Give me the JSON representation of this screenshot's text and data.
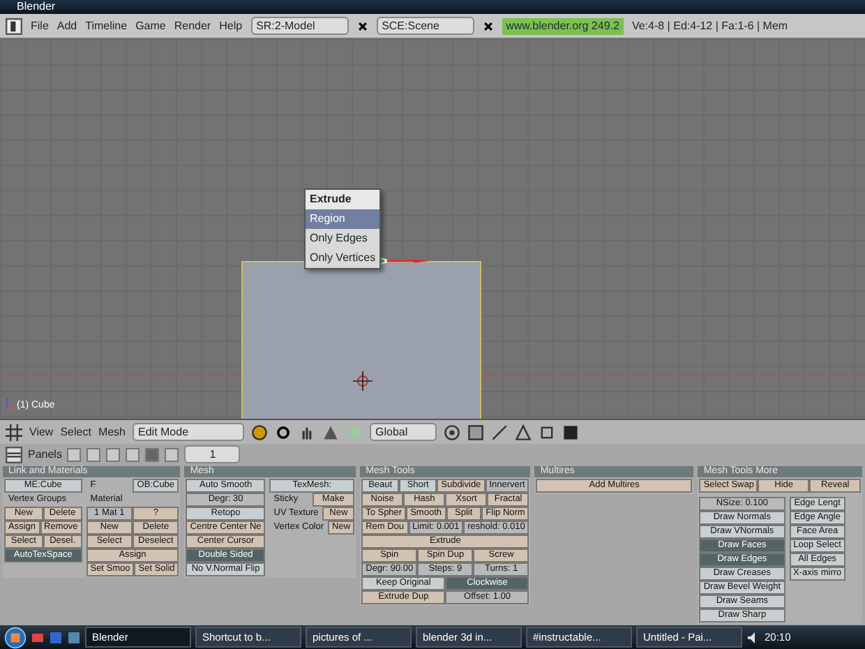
{
  "title_bar": {
    "title": "Blender"
  },
  "menu_bar": {
    "menus": [
      "File",
      "Add",
      "Timeline",
      "Game",
      "Render",
      "Help"
    ],
    "screen": "SR:2-Model",
    "scene": "SCE:Scene",
    "url": "www.blender.org 249.2",
    "stats": "Ve:4-8 | Ed:4-12 | Fa:1-6 | Mem"
  },
  "viewport": {
    "object_label": "(1) Cube",
    "popup": {
      "title": "Extrude",
      "items": [
        {
          "label": "Region",
          "selected": true
        },
        {
          "label": "Only Edges",
          "selected": false
        },
        {
          "label": "Only Vertices",
          "selected": false
        }
      ]
    }
  },
  "view_header": {
    "menus": [
      "View",
      "Select",
      "Mesh"
    ],
    "mode": "Edit Mode",
    "orientation": "Global"
  },
  "buttons_header": {
    "label": "Panels",
    "context_tabs": [
      {
        "selected": false
      },
      {
        "selected": false
      },
      {
        "selected": false
      },
      {
        "selected": false
      },
      {
        "selected": true
      },
      {
        "selected": false
      }
    ],
    "frame": "1"
  },
  "panels": [
    {
      "title": "Link and Materials",
      "columns": [
        [
          [
            {
              "label": "ME:Cube",
              "kind": "field"
            }
          ],
          [
            {
              "label": "Vertex Groups",
              "kind": "text"
            }
          ],
          [
            {
              "label": "New",
              "kind": "button"
            },
            {
              "label": "Delete",
              "kind": "button"
            }
          ],
          [
            {
              "label": "Assign",
              "kind": "button"
            },
            {
              "label": "Remove",
              "kind": "button"
            }
          ],
          [
            {
              "label": "Select",
              "kind": "button"
            },
            {
              "label": "Desel.",
              "kind": "button"
            }
          ],
          [
            {
              "label": "AutoTexSpace",
              "kind": "active"
            }
          ]
        ],
        [
          [
            {
              "label": "F",
              "kind": "text"
            },
            {
              "label": "OB:Cube",
              "kind": "field"
            }
          ],
          [
            {
              "label": "Material",
              "kind": "text"
            }
          ],
          [
            {
              "label": "1 Mat 1",
              "kind": "number"
            },
            {
              "label": "?",
              "kind": "button"
            }
          ],
          [
            {
              "label": "New",
              "kind": "button"
            },
            {
              "label": "Delete",
              "kind": "button"
            }
          ],
          [
            {
              "label": "Select",
              "kind": "button"
            },
            {
              "label": "Deselect",
              "kind": "button"
            }
          ],
          [
            {
              "label": "Assign",
              "kind": "button"
            }
          ],
          [
            {
              "label": "Set Smoo",
              "kind": "button"
            },
            {
              "label": "Set Solid",
              "kind": "button"
            }
          ]
        ]
      ]
    },
    {
      "title": "Mesh",
      "columns": [
        [
          [
            {
              "label": "Auto Smooth",
              "kind": "field"
            }
          ],
          [
            {
              "label": "Degr: 30",
              "kind": "number"
            }
          ],
          [
            {
              "label": "Retopo",
              "kind": "field"
            }
          ],
          [
            {
              "label": "Centre Center Ne",
              "kind": "button"
            }
          ],
          [
            {
              "label": "Center Cursor",
              "kind": "button"
            }
          ],
          [
            {
              "label": "Double Sided",
              "kind": "active"
            }
          ],
          [
            {
              "label": "No V.Normal Flip",
              "kind": "field"
            }
          ]
        ],
        [
          [
            {
              "label": "TexMesh:",
              "kind": "field"
            }
          ],
          [
            {
              "label": "Sticky",
              "kind": "text"
            },
            {
              "label": "Make",
              "kind": "button"
            }
          ],
          [
            {
              "label": "UV Texture",
              "kind": "text"
            },
            {
              "label": "New",
              "kind": "button"
            }
          ],
          [
            {
              "label": "Vertex Color",
              "kind": "text"
            },
            {
              "label": "New",
              "kind": "button"
            }
          ]
        ]
      ]
    },
    {
      "title": "Mesh Tools",
      "columns": [
        [
          [
            {
              "label": "Beaut",
              "kind": "field"
            },
            {
              "label": "Short",
              "kind": "field"
            },
            {
              "label": "Subdivide",
              "kind": "button"
            },
            {
              "label": "Innervert",
              "kind": "number"
            }
          ],
          [
            {
              "label": "Noise",
              "kind": "button"
            },
            {
              "label": "Hash",
              "kind": "button"
            },
            {
              "label": "Xsort",
              "kind": "button"
            },
            {
              "label": "Fractal",
              "kind": "button"
            }
          ],
          [
            {
              "label": "To Spher",
              "kind": "button"
            },
            {
              "label": "Smooth",
              "kind": "button"
            },
            {
              "label": "Split",
              "kind": "button"
            },
            {
              "label": "Flip Norm",
              "kind": "button"
            }
          ],
          [
            {
              "label": "Rem Dou",
              "kind": "button"
            },
            {
              "label": "Limit: 0.001",
              "kind": "number"
            },
            {
              "label": "reshold: 0.010",
              "kind": "number"
            }
          ],
          [
            {
              "label": "Extrude",
              "kind": "button"
            }
          ],
          [
            {
              "label": "Spin",
              "kind": "button"
            },
            {
              "label": "Spin Dup",
              "kind": "button"
            },
            {
              "label": "Screw",
              "kind": "button"
            }
          ],
          [
            {
              "label": "Degr: 90.00",
              "kind": "number"
            },
            {
              "label": "Steps: 9",
              "kind": "number"
            },
            {
              "label": "Turns: 1",
              "kind": "number"
            }
          ],
          [
            {
              "label": "Keep Original",
              "kind": "field"
            },
            {
              "label": "Clockwise",
              "kind": "active"
            }
          ],
          [
            {
              "label": "Extrude Dup",
              "kind": "button"
            },
            {
              "label": "Offset: 1.00",
              "kind": "number"
            }
          ]
        ]
      ]
    },
    {
      "title": "Multires",
      "columns": [
        [
          [
            {
              "label": "Add Multires",
              "kind": "button"
            }
          ]
        ]
      ]
    },
    {
      "title": "Mesh Tools More",
      "columns": [
        [
          [
            {
              "label": "Select Swap",
              "kind": "button"
            },
            {
              "label": "Hide",
              "kind": "button"
            },
            {
              "label": "Reveal",
              "kind": "button"
            }
          ]
        ],
        [
          [
            {
              "label": "NSize: 0.100",
              "kind": "number"
            }
          ],
          [
            {
              "label": "Draw Normals",
              "kind": "field"
            }
          ],
          [
            {
              "label": "Draw VNormals",
              "kind": "field"
            }
          ],
          [
            {
              "label": "Draw Faces",
              "kind": "active"
            }
          ],
          [
            {
              "label": "Draw Edges",
              "kind": "active"
            }
          ],
          [
            {
              "label": "Draw Creases",
              "kind": "field"
            }
          ],
          [
            {
              "label": "Draw Bevel Weight",
              "kind": "field"
            }
          ],
          [
            {
              "label": "Draw Seams",
              "kind": "field"
            }
          ],
          [
            {
              "label": "Draw Sharp",
              "kind": "field"
            }
          ]
        ],
        [
          [
            {
              "label": "Edge Lengt",
              "kind": "field"
            }
          ],
          [
            {
              "label": "Edge Angle",
              "kind": "field"
            }
          ],
          [
            {
              "label": "Face Area",
              "kind": "field"
            }
          ],
          [
            {
              "label": "Loop Select",
              "kind": "field"
            }
          ],
          [
            {
              "label": "All Edges",
              "kind": "field"
            }
          ],
          [
            {
              "label": "X-axis mirro",
              "kind": "field"
            }
          ]
        ]
      ]
    }
  ],
  "taskbar": {
    "tasks": [
      {
        "label": "Blender",
        "selected": true
      },
      {
        "label": "Shortcut to b...",
        "selected": false
      },
      {
        "label": "pictures of ...",
        "selected": false
      },
      {
        "label": "blender 3d in...",
        "selected": false
      },
      {
        "label": "#instructable...",
        "selected": false
      },
      {
        "label": "Untitled - Pai...",
        "selected": false
      }
    ],
    "clock": "20:10"
  }
}
